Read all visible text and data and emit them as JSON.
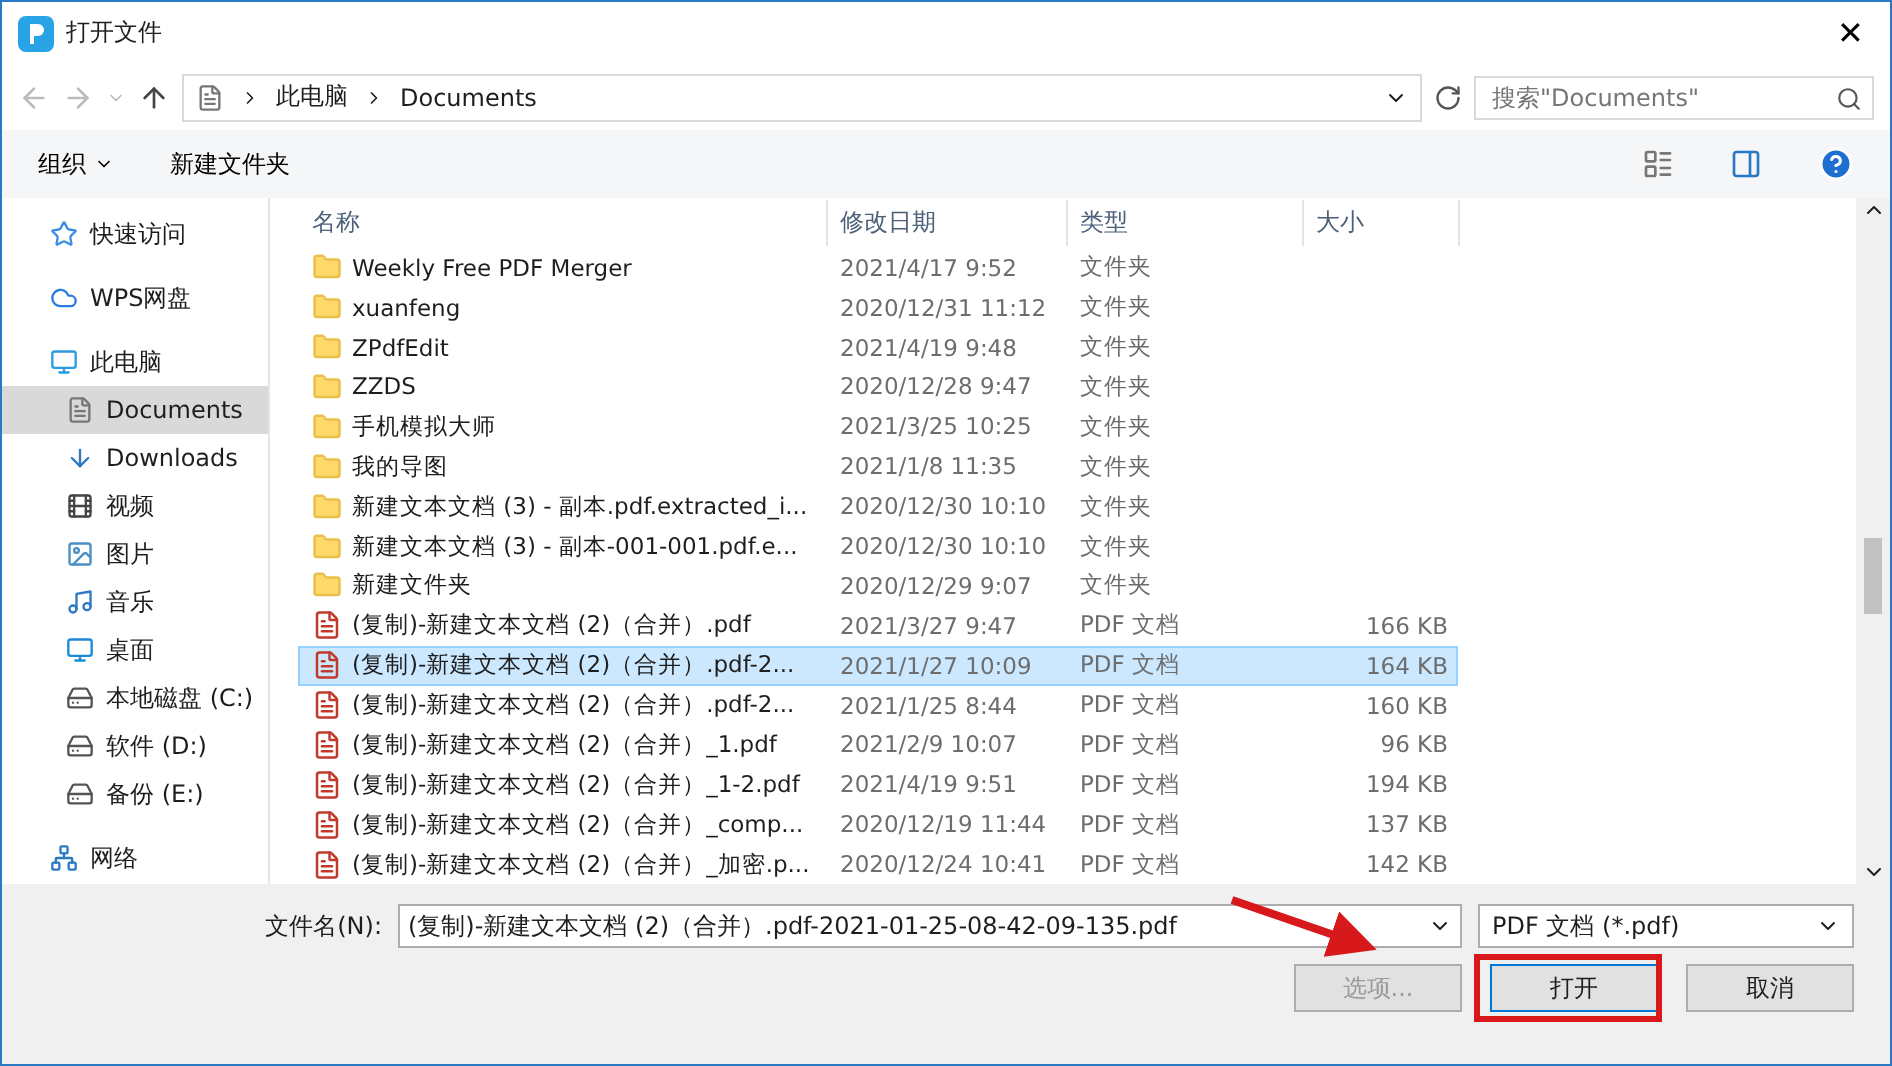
{
  "window": {
    "title": "打开文件",
    "close": "✕"
  },
  "nav": {
    "path": [
      "此电脑",
      "Documents"
    ],
    "search_placeholder": "搜索\"Documents\""
  },
  "toolbar": {
    "organize": "组织",
    "new_folder": "新建文件夹"
  },
  "sidebar": {
    "items": [
      {
        "label": "快速访问",
        "selected": false
      },
      {
        "label": "WPS网盘",
        "selected": false
      },
      {
        "label": "此电脑",
        "selected": false,
        "children": [
          {
            "label": "Documents",
            "selected": true
          },
          {
            "label": "Downloads",
            "selected": false
          },
          {
            "label": "视频",
            "selected": false
          },
          {
            "label": "图片",
            "selected": false
          },
          {
            "label": "音乐",
            "selected": false
          },
          {
            "label": "桌面",
            "selected": false
          },
          {
            "label": "本地磁盘 (C:)",
            "selected": false
          },
          {
            "label": "软件 (D:)",
            "selected": false
          },
          {
            "label": "备份 (E:)",
            "selected": false
          }
        ]
      },
      {
        "label": "网络",
        "selected": false
      }
    ]
  },
  "table": {
    "columns": [
      "名称",
      "修改日期",
      "类型",
      "大小"
    ],
    "rows": [
      {
        "kind": "folder",
        "name": "Weekly Free PDF Merger",
        "date": "2021/4/17 9:52",
        "type": "文件夹",
        "size": "",
        "selected": false
      },
      {
        "kind": "folder",
        "name": "xuanfeng",
        "date": "2020/12/31 11:12",
        "type": "文件夹",
        "size": "",
        "selected": false
      },
      {
        "kind": "folder",
        "name": "ZPdfEdit",
        "date": "2021/4/19 9:48",
        "type": "文件夹",
        "size": "",
        "selected": false
      },
      {
        "kind": "folder",
        "name": "ZZDS",
        "date": "2020/12/28 9:47",
        "type": "文件夹",
        "size": "",
        "selected": false
      },
      {
        "kind": "folder",
        "name": "手机模拟大师",
        "date": "2021/3/25 10:25",
        "type": "文件夹",
        "size": "",
        "selected": false
      },
      {
        "kind": "folder",
        "name": "我的导图",
        "date": "2021/1/8 11:35",
        "type": "文件夹",
        "size": "",
        "selected": false
      },
      {
        "kind": "folder",
        "name": "新建文本文档 (3) - 副本.pdf.extracted_i...",
        "date": "2020/12/30 10:10",
        "type": "文件夹",
        "size": "",
        "selected": false
      },
      {
        "kind": "folder",
        "name": "新建文本文档 (3) - 副本-001-001.pdf.e...",
        "date": "2020/12/30 10:10",
        "type": "文件夹",
        "size": "",
        "selected": false
      },
      {
        "kind": "folder",
        "name": "新建文件夹",
        "date": "2020/12/29 9:07",
        "type": "文件夹",
        "size": "",
        "selected": false
      },
      {
        "kind": "pdf",
        "name": "(复制)-新建文本文档 (2)（合并）.pdf",
        "date": "2021/3/27 9:47",
        "type": "PDF 文档",
        "size": "166 KB",
        "selected": false
      },
      {
        "kind": "pdf",
        "name": "(复制)-新建文本文档 (2)（合并）.pdf-2...",
        "date": "2021/1/27 10:09",
        "type": "PDF 文档",
        "size": "164 KB",
        "selected": true
      },
      {
        "kind": "pdf",
        "name": "(复制)-新建文本文档 (2)（合并）.pdf-2...",
        "date": "2021/1/25 8:44",
        "type": "PDF 文档",
        "size": "160 KB",
        "selected": false
      },
      {
        "kind": "pdf",
        "name": "(复制)-新建文本文档 (2)（合并）_1.pdf",
        "date": "2021/2/9 10:07",
        "type": "PDF 文档",
        "size": "96 KB",
        "selected": false
      },
      {
        "kind": "pdf",
        "name": "(复制)-新建文本文档 (2)（合并）_1-2.pdf",
        "date": "2021/4/19 9:51",
        "type": "PDF 文档",
        "size": "194 KB",
        "selected": false
      },
      {
        "kind": "pdf",
        "name": "(复制)-新建文本文档 (2)（合并）_comp...",
        "date": "2020/12/19 11:44",
        "type": "PDF 文档",
        "size": "137 KB",
        "selected": false
      },
      {
        "kind": "pdf",
        "name": "(复制)-新建文本文档 (2)（合并）_加密.p...",
        "date": "2020/12/24 10:41",
        "type": "PDF 文档",
        "size": "142 KB",
        "selected": false
      }
    ]
  },
  "footer": {
    "filename_label": "文件名(N):",
    "filename": "(复制)-新建文本文档 (2)（合并）.pdf-2021-01-25-08-42-09-135.pdf",
    "filter": "PDF 文档 (*.pdf)",
    "buttons": [
      {
        "label": "选项...",
        "disabled": true
      },
      {
        "label": "打开",
        "disabled": false
      },
      {
        "label": "取消",
        "disabled": false
      }
    ]
  },
  "callout": {
    "arrow": true,
    "open_button_highlighted": true
  }
}
